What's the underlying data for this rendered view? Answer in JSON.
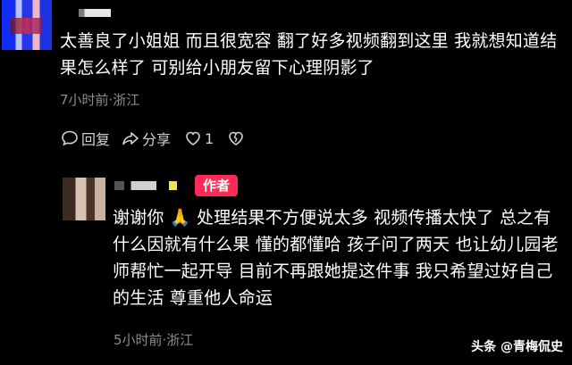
{
  "comment1": {
    "text": "太善良了小姐姐 而且很宽容 翻了好多视频翻到这里 我就想知道结果怎么样了 可别给小朋友留下心理阴影了",
    "meta": "7小时前·浙江",
    "actions": {
      "reply": "回复",
      "share": "分享",
      "like_count": "1"
    }
  },
  "comment2": {
    "badge": "作者",
    "text_before": "谢谢你 ",
    "emoji": "🙏",
    "text_after": " 处理结果不方便说太多 视频传播太快了 总之有什么因就有什么果 懂的都懂哈 孩子问了两天 也让幼儿园老师帮忙一起开导 目前不再跟她提这件事 我只希望过好自己的生活 尊重他人命运",
    "meta": "5小时前·浙江"
  },
  "watermark": {
    "text": "头条 @青梅侃史"
  },
  "colors": {
    "background": "#000000",
    "meta_text": "#8c8c8c",
    "badge": "#ff2a55"
  }
}
